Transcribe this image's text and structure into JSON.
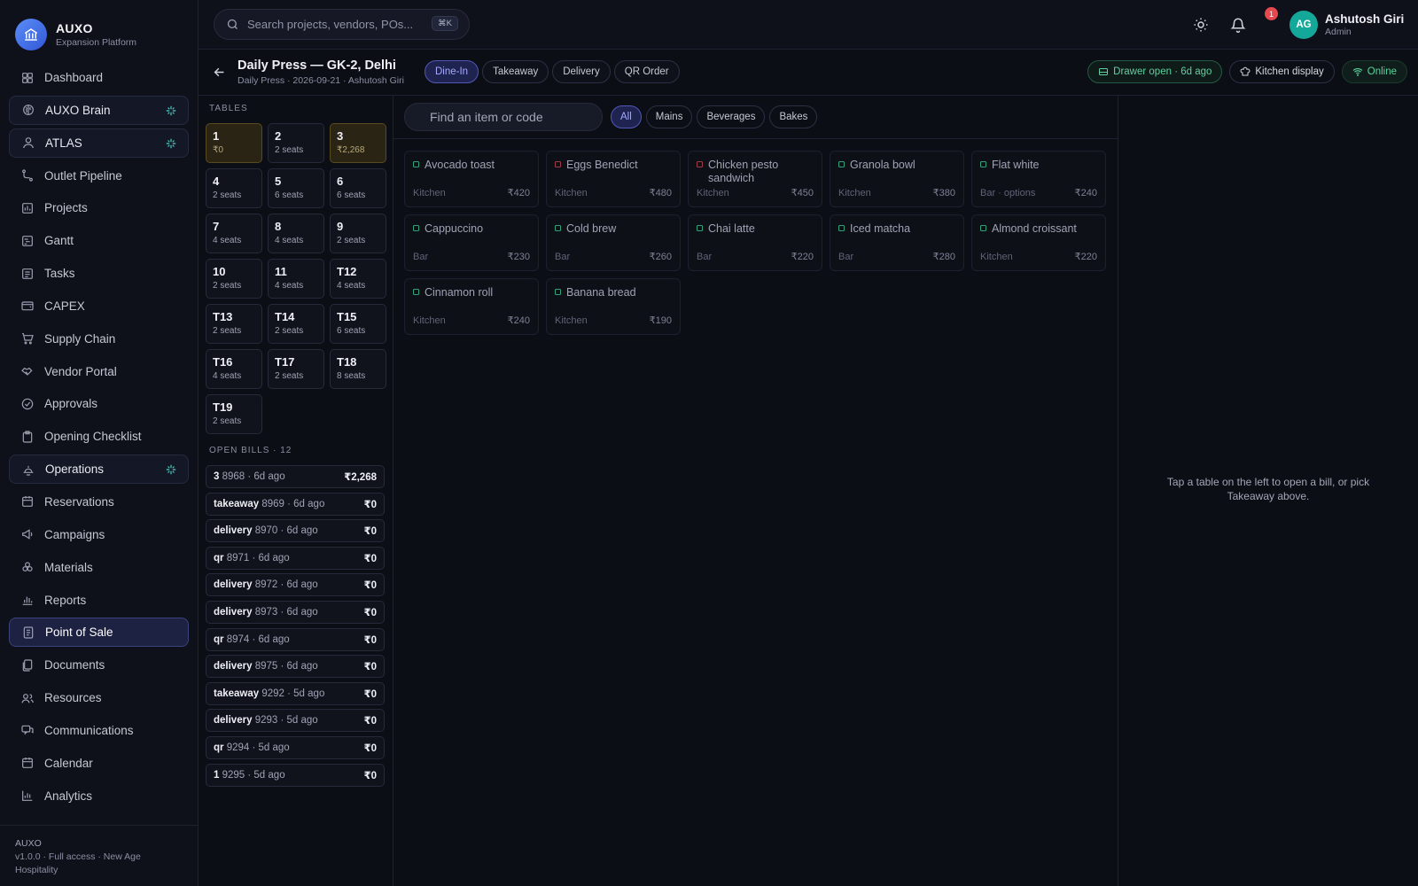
{
  "brand": {
    "name": "AUXO",
    "subtitle": "Expansion Platform"
  },
  "search": {
    "placeholder": "Search projects, vendors, POs...",
    "shortcut": "⌘K"
  },
  "user": {
    "initials": "AG",
    "name": "Ashutosh Giri",
    "role": "Admin",
    "notifications": "1"
  },
  "sidebar": {
    "items": [
      {
        "label": "Dashboard",
        "icon": "grid-icon"
      },
      {
        "label": "AUXO Brain",
        "icon": "brain-icon",
        "style": "pill",
        "spark": true
      },
      {
        "label": "ATLAS",
        "icon": "user-icon",
        "style": "pill",
        "spark": true
      },
      {
        "label": "Outlet Pipeline",
        "icon": "pipeline-icon"
      },
      {
        "label": "Projects",
        "icon": "projects-icon"
      },
      {
        "label": "Gantt",
        "icon": "gantt-icon"
      },
      {
        "label": "Tasks",
        "icon": "tasks-icon"
      },
      {
        "label": "CAPEX",
        "icon": "wallet-icon"
      },
      {
        "label": "Supply Chain",
        "icon": "cart-icon"
      },
      {
        "label": "Vendor Portal",
        "icon": "handshake-icon"
      },
      {
        "label": "Approvals",
        "icon": "check-circle-icon"
      },
      {
        "label": "Opening Checklist",
        "icon": "clipboard-icon"
      },
      {
        "label": "Operations",
        "icon": "bell-service-icon",
        "style": "pill",
        "spark": true
      },
      {
        "label": "Reservations",
        "icon": "calendar-icon"
      },
      {
        "label": "Campaigns",
        "icon": "megaphone-icon"
      },
      {
        "label": "Materials",
        "icon": "materials-icon"
      },
      {
        "label": "Reports",
        "icon": "bar-chart-icon"
      },
      {
        "label": "Point of Sale",
        "icon": "receipt-icon",
        "style": "active"
      },
      {
        "label": "Documents",
        "icon": "documents-icon"
      },
      {
        "label": "Resources",
        "icon": "users-icon"
      },
      {
        "label": "Communications",
        "icon": "chat-icon"
      },
      {
        "label": "Calendar",
        "icon": "calendar-icon"
      },
      {
        "label": "Analytics",
        "icon": "analytics-icon"
      }
    ],
    "footer": {
      "title": "AUXO",
      "line": "v1.0.0 · Full access · New Age Hospitality"
    }
  },
  "header": {
    "title": "Daily Press — GK-2, Delhi",
    "subtitle": "Daily Press · 2026-09-21 · Ashutosh Giri",
    "modes": [
      "Dine-In",
      "Takeaway",
      "Delivery",
      "QR Order"
    ],
    "active_mode": "Dine-In",
    "drawer": "Drawer open · 6d ago",
    "kitchen": "Kitchen display",
    "status": "Online"
  },
  "tables": {
    "label": "TABLES",
    "items": [
      {
        "num": "1",
        "sub": "₹0",
        "busy": true
      },
      {
        "num": "2",
        "sub": "2 seats"
      },
      {
        "num": "3",
        "sub": "₹2,268",
        "busy": true
      },
      {
        "num": "4",
        "sub": "2 seats"
      },
      {
        "num": "5",
        "sub": "6 seats"
      },
      {
        "num": "6",
        "sub": "6 seats"
      },
      {
        "num": "7",
        "sub": "4 seats"
      },
      {
        "num": "8",
        "sub": "4 seats"
      },
      {
        "num": "9",
        "sub": "2 seats"
      },
      {
        "num": "10",
        "sub": "2 seats"
      },
      {
        "num": "11",
        "sub": "4 seats"
      },
      {
        "num": "T12",
        "sub": "4 seats"
      },
      {
        "num": "T13",
        "sub": "2 seats"
      },
      {
        "num": "T14",
        "sub": "2 seats"
      },
      {
        "num": "T15",
        "sub": "6 seats"
      },
      {
        "num": "T16",
        "sub": "4 seats"
      },
      {
        "num": "T17",
        "sub": "2 seats"
      },
      {
        "num": "T18",
        "sub": "8 seats"
      },
      {
        "num": "T19",
        "sub": "2 seats"
      }
    ]
  },
  "open_bills": {
    "label": "OPEN BILLS · 12",
    "items": [
      {
        "type": "3",
        "meta": "8968 · 6d ago",
        "amount": "₹2,268"
      },
      {
        "type": "takeaway",
        "meta": "8969 · 6d ago",
        "amount": "₹0"
      },
      {
        "type": "delivery",
        "meta": "8970 · 6d ago",
        "amount": "₹0"
      },
      {
        "type": "qr",
        "meta": "8971 · 6d ago",
        "amount": "₹0"
      },
      {
        "type": "delivery",
        "meta": "8972 · 6d ago",
        "amount": "₹0"
      },
      {
        "type": "delivery",
        "meta": "8973 · 6d ago",
        "amount": "₹0"
      },
      {
        "type": "qr",
        "meta": "8974 · 6d ago",
        "amount": "₹0"
      },
      {
        "type": "delivery",
        "meta": "8975 · 6d ago",
        "amount": "₹0"
      },
      {
        "type": "takeaway",
        "meta": "9292 · 5d ago",
        "amount": "₹0"
      },
      {
        "type": "delivery",
        "meta": "9293 · 5d ago",
        "amount": "₹0"
      },
      {
        "type": "qr",
        "meta": "9294 · 5d ago",
        "amount": "₹0"
      },
      {
        "type": "1",
        "meta": "9295 · 5d ago",
        "amount": "₹0"
      }
    ]
  },
  "menu": {
    "search_placeholder": "Find an item or code",
    "categories": [
      "All",
      "Mains",
      "Beverages",
      "Bakes"
    ],
    "active_category": "All",
    "items": [
      {
        "name": "Avocado toast",
        "station": "Kitchen",
        "price": "₹420",
        "veg": true
      },
      {
        "name": "Eggs Benedict",
        "station": "Kitchen",
        "price": "₹480",
        "veg": false
      },
      {
        "name": "Chicken pesto sandwich",
        "station": "Kitchen",
        "price": "₹450",
        "veg": false
      },
      {
        "name": "Granola bowl",
        "station": "Kitchen",
        "price": "₹380",
        "veg": true
      },
      {
        "name": "Flat white",
        "station": "Bar · options",
        "price": "₹240",
        "veg": true
      },
      {
        "name": "Cappuccino",
        "station": "Bar",
        "price": "₹230",
        "veg": true
      },
      {
        "name": "Cold brew",
        "station": "Bar",
        "price": "₹260",
        "veg": true
      },
      {
        "name": "Chai latte",
        "station": "Bar",
        "price": "₹220",
        "veg": true
      },
      {
        "name": "Iced matcha",
        "station": "Bar",
        "price": "₹280",
        "veg": true
      },
      {
        "name": "Almond croissant",
        "station": "Kitchen",
        "price": "₹220",
        "veg": true
      },
      {
        "name": "Cinnamon roll",
        "station": "Kitchen",
        "price": "₹240",
        "veg": true
      },
      {
        "name": "Banana bread",
        "station": "Kitchen",
        "price": "₹190",
        "veg": true
      }
    ]
  },
  "bill_panel": {
    "empty_message": "Tap a table on the left to open a bill, or pick Takeaway above."
  },
  "colors": {
    "accent": "#5257b8",
    "online": "#5fd0a0",
    "busy_table": "#5a4a1f",
    "veg": "#2fa37a",
    "nonveg": "#a33a4a"
  }
}
